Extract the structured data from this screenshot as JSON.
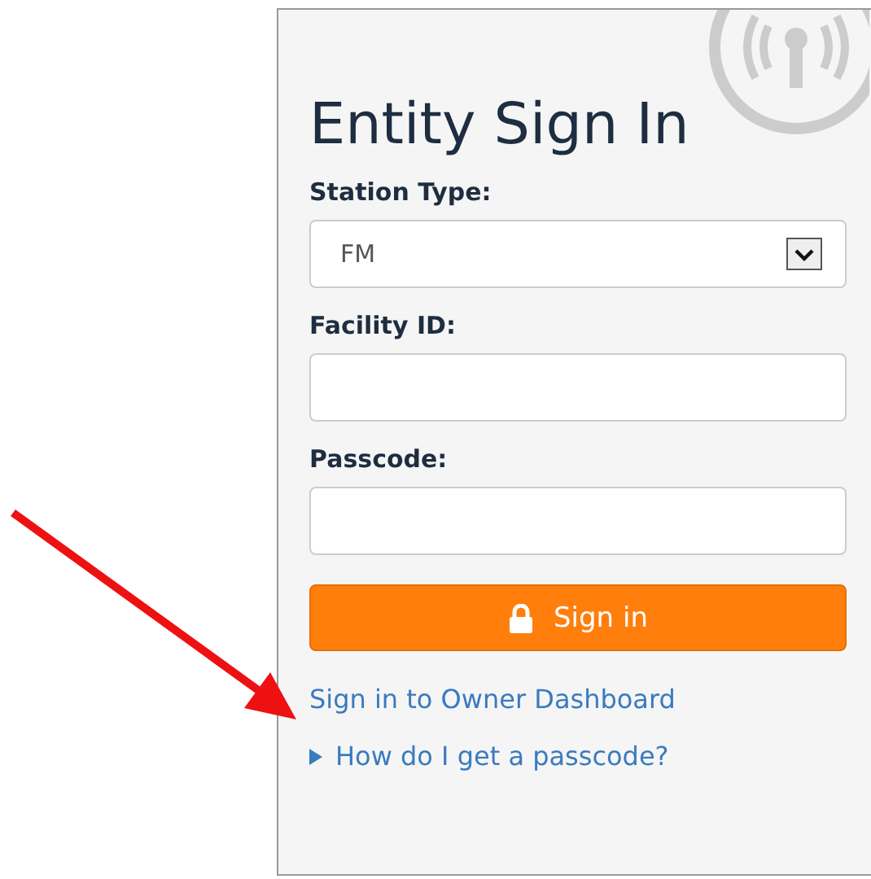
{
  "title": "Entity Sign In",
  "fields": [
    {
      "kind": "select",
      "label": "Station Type:",
      "value": "FM"
    },
    {
      "kind": "text",
      "label": "Facility ID:"
    },
    {
      "kind": "text",
      "label": "Passcode:"
    }
  ],
  "button": "Sign in",
  "link": "Sign in to Owner Dashboard",
  "disclosure": {
    "label": "How do I get a passcode?",
    "expanded": false
  }
}
